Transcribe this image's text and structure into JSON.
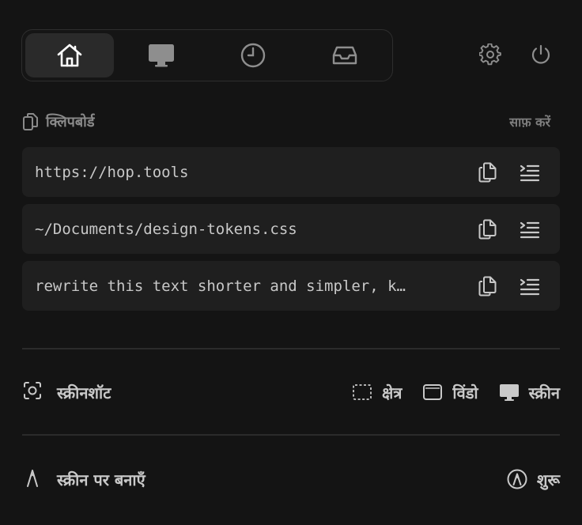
{
  "tabs": [
    {
      "name": "home",
      "icon": "home-icon",
      "active": true
    },
    {
      "name": "display",
      "icon": "monitor-icon",
      "active": false
    },
    {
      "name": "history",
      "icon": "clock-icon",
      "active": false
    },
    {
      "name": "inbox",
      "icon": "inbox-icon",
      "active": false
    }
  ],
  "header_actions": {
    "settings_icon": "gear-icon",
    "power_icon": "power-icon"
  },
  "clipboard": {
    "label": "क्लिपबोर्ड",
    "clear_label": "साफ़ करें",
    "items": [
      {
        "text": "https://hop.tools"
      },
      {
        "text": "~/Documents/design-tokens.css"
      },
      {
        "text": "rewrite this text shorter and simpler, k…"
      }
    ]
  },
  "screenshot": {
    "label": "स्क्रीनशॉट",
    "options": [
      {
        "label": "क्षेत्र",
        "icon": "region-select-icon"
      },
      {
        "label": "विंडो",
        "icon": "window-icon"
      },
      {
        "label": "स्क्रीन",
        "icon": "screen-icon"
      }
    ]
  },
  "draw": {
    "label": "स्क्रीन पर बनाएँ",
    "start_label": "शुरू"
  },
  "colors": {
    "background": "#141414",
    "item_bg": "#1f1f1f",
    "active_tab": "#2a2a2a"
  }
}
